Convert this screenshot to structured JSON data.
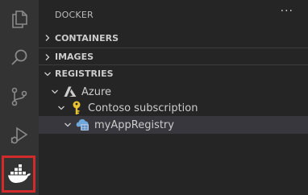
{
  "activity_bar": {
    "items": [
      {
        "name": "explorer",
        "icon": "files-icon"
      },
      {
        "name": "search",
        "icon": "search-icon"
      },
      {
        "name": "source-control",
        "icon": "source-control-icon"
      },
      {
        "name": "run-debug",
        "icon": "run-debug-icon"
      },
      {
        "name": "docker",
        "icon": "docker-icon",
        "active": true
      }
    ],
    "highlight_color": "#d12b2b"
  },
  "sidebar": {
    "title": "DOCKER",
    "more_label": "···",
    "sections": [
      {
        "label": "CONTAINERS",
        "expanded": false
      },
      {
        "label": "IMAGES",
        "expanded": false
      },
      {
        "label": "REGISTRIES",
        "expanded": true
      }
    ],
    "tree": [
      {
        "label": "Azure",
        "icon": "azure-icon",
        "level": 1,
        "expanded": true
      },
      {
        "label": "Contoso subscription",
        "icon": "key-icon",
        "level": 2,
        "expanded": true
      },
      {
        "label": "myAppRegistry",
        "icon": "container-registry-icon",
        "level": 3,
        "expanded": true,
        "selected": true
      }
    ]
  },
  "colors": {
    "activity_bg": "#333333",
    "sidebar_bg": "#252526",
    "selected_row": "#37373d",
    "key": "#e8c233",
    "docker_icon": "#ffffff"
  }
}
